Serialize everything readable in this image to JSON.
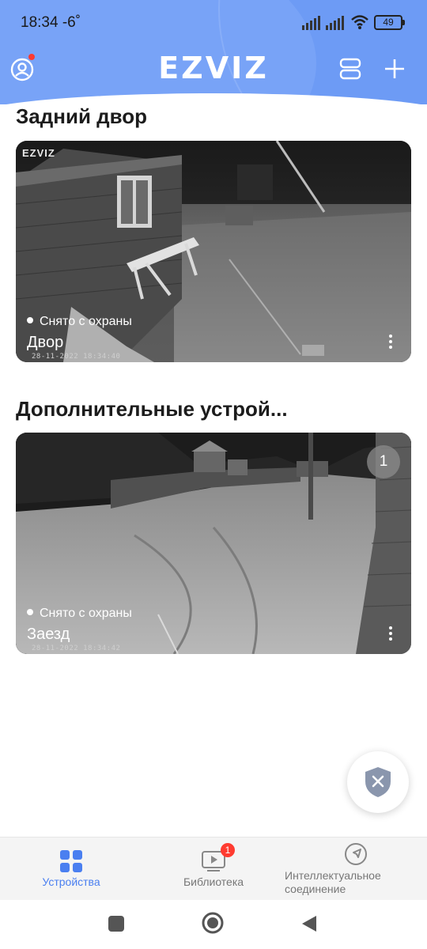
{
  "status_bar": {
    "time": "18:34",
    "temp": "-6˚",
    "battery": "49"
  },
  "header": {
    "logo": "EZVIZ"
  },
  "sections": [
    {
      "title": "Задний двор",
      "camera": {
        "watermark": "EZVIZ",
        "status": "Снято с охраны",
        "name": "Двор",
        "timestamp": "28-11-2022 18:34:40"
      }
    },
    {
      "title": "Дополнительные устрой...",
      "camera": {
        "status": "Снято с охраны",
        "name": "Заезд",
        "timestamp": "28-11-2022 18:34:42",
        "badge": "1"
      }
    }
  ],
  "tabs": [
    {
      "label": "Устройства",
      "icon": "grid-icon",
      "active": true
    },
    {
      "label": "Библиотека",
      "icon": "library-icon",
      "badge": "1"
    },
    {
      "label": "Интеллектуальное соединение",
      "icon": "navigation-icon"
    }
  ],
  "colors": {
    "accent": "#4a7ff0",
    "header": "#6d9bf5",
    "badge": "#ff3b30"
  }
}
